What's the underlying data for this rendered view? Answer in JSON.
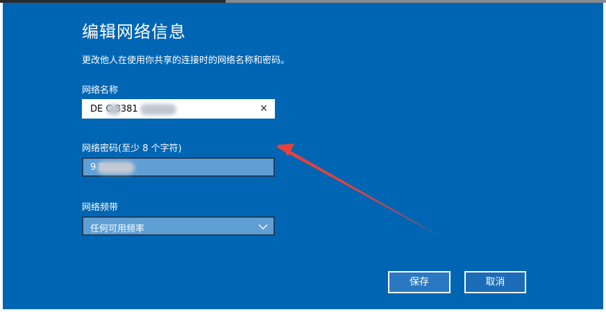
{
  "dialog": {
    "title": "编辑网络信息",
    "description": "更改他人在使用你共享的连接时的网络名称和密码。"
  },
  "network_name": {
    "label": "网络名称",
    "value": "DE C 8381",
    "clear_icon": "close-icon"
  },
  "network_password": {
    "label": "网络密码(至少 8 个字符)",
    "value": "9 8,"
  },
  "network_band": {
    "label": "网络频带",
    "selected": "任何可用频率",
    "dropdown_icon": "chevron-down-icon"
  },
  "buttons": {
    "save_label": "保存",
    "cancel_label": "取消"
  },
  "colors": {
    "dialog_background": "#0066b4",
    "annotation_arrow": "#e8413a"
  }
}
